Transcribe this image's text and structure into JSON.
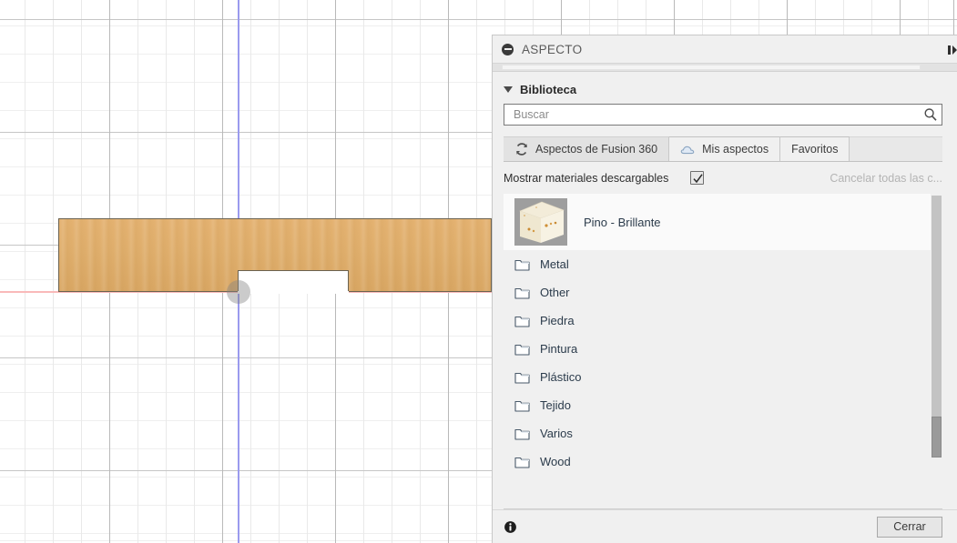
{
  "panel": {
    "title": "ASPECTO",
    "collapse_icon": "collapse-minus-icon",
    "dock_icon": "dock-panel-icon"
  },
  "library": {
    "section_label": "Biblioteca",
    "expand_icon": "triangle-down-icon",
    "search": {
      "value": "",
      "placeholder": "Buscar",
      "icon": "search-icon"
    },
    "tabs": [
      {
        "label": "Aspectos de Fusion 360",
        "icon": "refresh-icon",
        "active": false
      },
      {
        "label": "Mis aspectos",
        "icon": "cloud-icon",
        "active": true
      },
      {
        "label": "Favoritos",
        "icon": "",
        "active": false
      }
    ],
    "options": {
      "show_downloadable_label": "Mostrar materiales descargables",
      "show_downloadable_checked": true,
      "cancel_all_label": "Cancelar todas las c..."
    },
    "materials": [
      {
        "label": "Pino - Brillante",
        "thumb": "pine-cube-thumbnail"
      }
    ],
    "folders": [
      {
        "label": "Metal",
        "icon": "folder-icon"
      },
      {
        "label": "Other",
        "icon": "folder-icon"
      },
      {
        "label": "Piedra",
        "icon": "folder-icon"
      },
      {
        "label": "Pintura",
        "icon": "folder-icon"
      },
      {
        "label": "Plástico",
        "icon": "folder-icon"
      },
      {
        "label": "Tejido",
        "icon": "folder-icon"
      },
      {
        "label": "Varios",
        "icon": "folder-icon"
      },
      {
        "label": "Wood",
        "icon": "folder-icon"
      }
    ]
  },
  "footer": {
    "info_icon": "info-icon",
    "close_label": "Cerrar"
  },
  "viewport": {
    "background": "#ffffff",
    "grid_minor_color": "#ececec",
    "grid_major_color": "#bfbfbf",
    "x_axis_color": "#f9b9b9",
    "y_axis_color": "#9a9aee",
    "origin_marker": "origin-point-marker",
    "body_material_color": "#dfae6c",
    "body_edge_color": "#6b6250"
  }
}
